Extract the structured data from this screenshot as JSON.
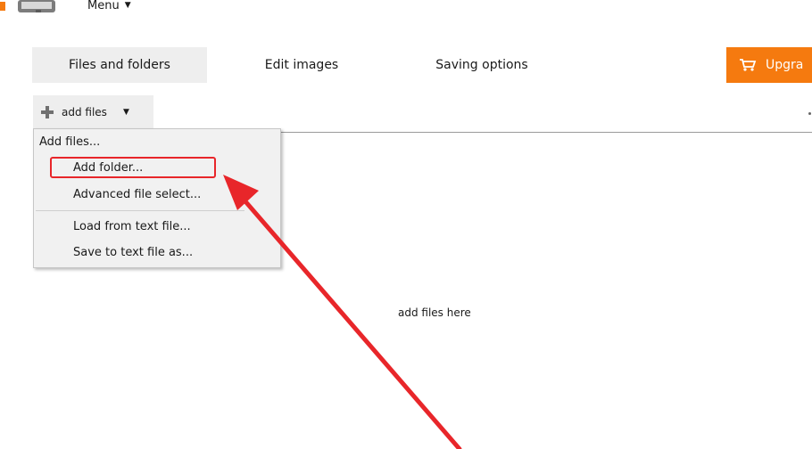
{
  "header": {
    "menu_label": "Menu"
  },
  "tabs": [
    {
      "label": "Files and folders",
      "active": true
    },
    {
      "label": "Edit images",
      "active": false
    },
    {
      "label": "Saving options",
      "active": false
    }
  ],
  "upgrade": {
    "label": "Upgra",
    "color": "#f57a0f"
  },
  "toolbar": {
    "add_files_label": "add files"
  },
  "dropdown": {
    "items": [
      {
        "label": "Add files..."
      },
      {
        "label": "Add folder..."
      },
      {
        "label": "Advanced file select..."
      },
      {
        "label": "Load from text file..."
      },
      {
        "label": "Save to text file as..."
      }
    ],
    "highlighted_item": "Add folder..."
  },
  "main": {
    "drop_hint": "add files here"
  },
  "annotation": {
    "highlight_color": "#e8262a",
    "arrow_color": "#e8262a"
  }
}
